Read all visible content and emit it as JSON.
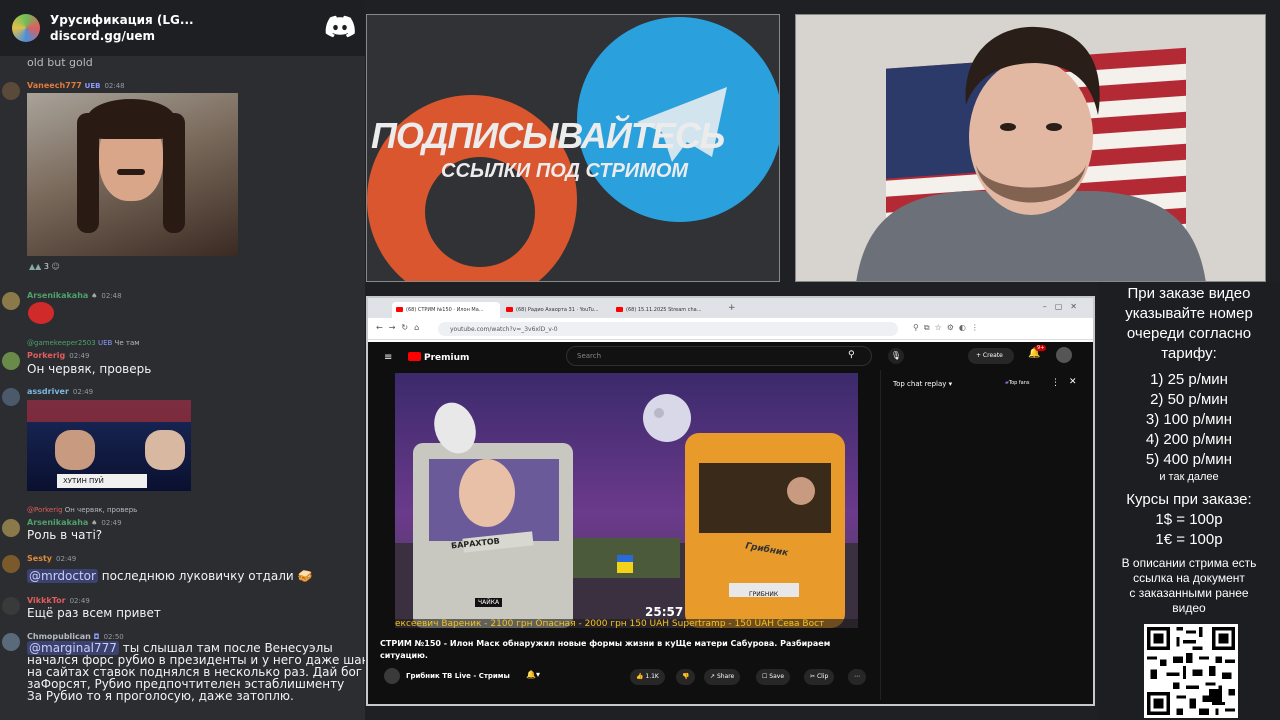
{
  "discord": {
    "server_name": "Урусификация (LG...",
    "server_link": "discord.gg/uem",
    "top_cut_text": "old but gold",
    "messages": [
      {
        "user": "Vaneech777",
        "badge": "UEB",
        "time": "02:48",
        "user_color": "#e07a3c",
        "reaction": "3"
      },
      {
        "user": "Arsenikakaha",
        "time": "02:48",
        "user_color": "#4fa16a"
      },
      {
        "reply_user": "@gamekeeper2503",
        "reply_badge": "UEB",
        "reply_text": "Че там",
        "user": "Porkerig",
        "time": "02:49",
        "user_color": "#e05d5d",
        "text": "Он червяк, проверь"
      },
      {
        "user": "assdriver",
        "time": "02:49",
        "user_color": "#7ab8e0",
        "image_caption": "ХУТИН ПУЙ"
      },
      {
        "reply_user": "@Porkerig",
        "reply_text": "Он червяк, проверь",
        "user": "Arsenikakaha",
        "time": "02:49",
        "user_color": "#4fa16a",
        "text": "Роль в чаті?"
      },
      {
        "user": "Sesty",
        "time": "02:49",
        "user_color": "#e08a3c",
        "mention": "@mrdoctor",
        "text": "последнюю луковичку отдали"
      },
      {
        "user": "VikkkTor",
        "time": "02:49",
        "user_color": "#e05d5d",
        "text": "Ещё раз всем привет"
      },
      {
        "user": "Chmopublican",
        "time": "02:50",
        "user_color": "#b5bac1",
        "mention": "@marginal777",
        "text": "ты слышал там после Венесуэлы",
        "cont": [
          "начался форс рубио в президенты и у него даже шанс",
          "на сайтах ставок поднялся в несколько раз. Дай бог",
          "заФорсят, Рубио предпочтителен эстаблишменту",
          "За Рубио то я проголосую, даже затоплю."
        ]
      }
    ]
  },
  "banner": {
    "headline": "ПОДПИСЫВАЙТЕСЬ",
    "subline": "ССЫЛКИ ПОД СТРИМОМ"
  },
  "browser": {
    "tabs": [
      "(68) СТРИМ №150 · Илон Ма...",
      "(68) Радио Ахаорта 31 · YouTu...",
      "(68) 15.11.2025 Stream cha..."
    ],
    "url": "youtube.com/watch?v=_3v6xlD_v-0",
    "yt_logo": "Premium",
    "search_placeholder": "Search",
    "create_label": "+ Create",
    "notif_count": "9+",
    "chat_replay": "Top chat replay",
    "top_fans": "Top fans",
    "video_time": "25:57",
    "ticker": "ексеевич Вареник - 2100 грн   Опасная - 2000 грн 150 UAH   Supertramp - 150 UAH   Сева Вост",
    "video_title": "СТРИМ №150 - Илон Маск обнаружил новые формы жизни в куЩе матери Сабурова. Разбираем ситуацию.",
    "channel_name": "Грибник ТВ Live - Стримы",
    "likes": "1.1K",
    "share": "Share",
    "save": "Save",
    "clip": "Clip",
    "sign_left": "БАРАХТОВ",
    "plate_left": "ЧАЙКА",
    "plate_right": "ГРИБНИК",
    "van_text": "Грибник"
  },
  "info": {
    "intro": [
      "При заказе видео",
      "указывайте номер",
      "очереди согласно",
      "тарифу:"
    ],
    "rates": [
      "1) 25 р/мин",
      "2) 50 р/мин",
      "3) 100 р/мин",
      "4) 200 р/мин",
      "5) 400 р/мин"
    ],
    "rates_more": "и так далее",
    "courses_title": "Курсы при заказе:",
    "courses": [
      "1$ = 100р",
      "1€ = 100р"
    ],
    "footer": [
      "В описании стрима есть",
      "ссылка на документ",
      "с заказанными ранее",
      "видео"
    ]
  }
}
